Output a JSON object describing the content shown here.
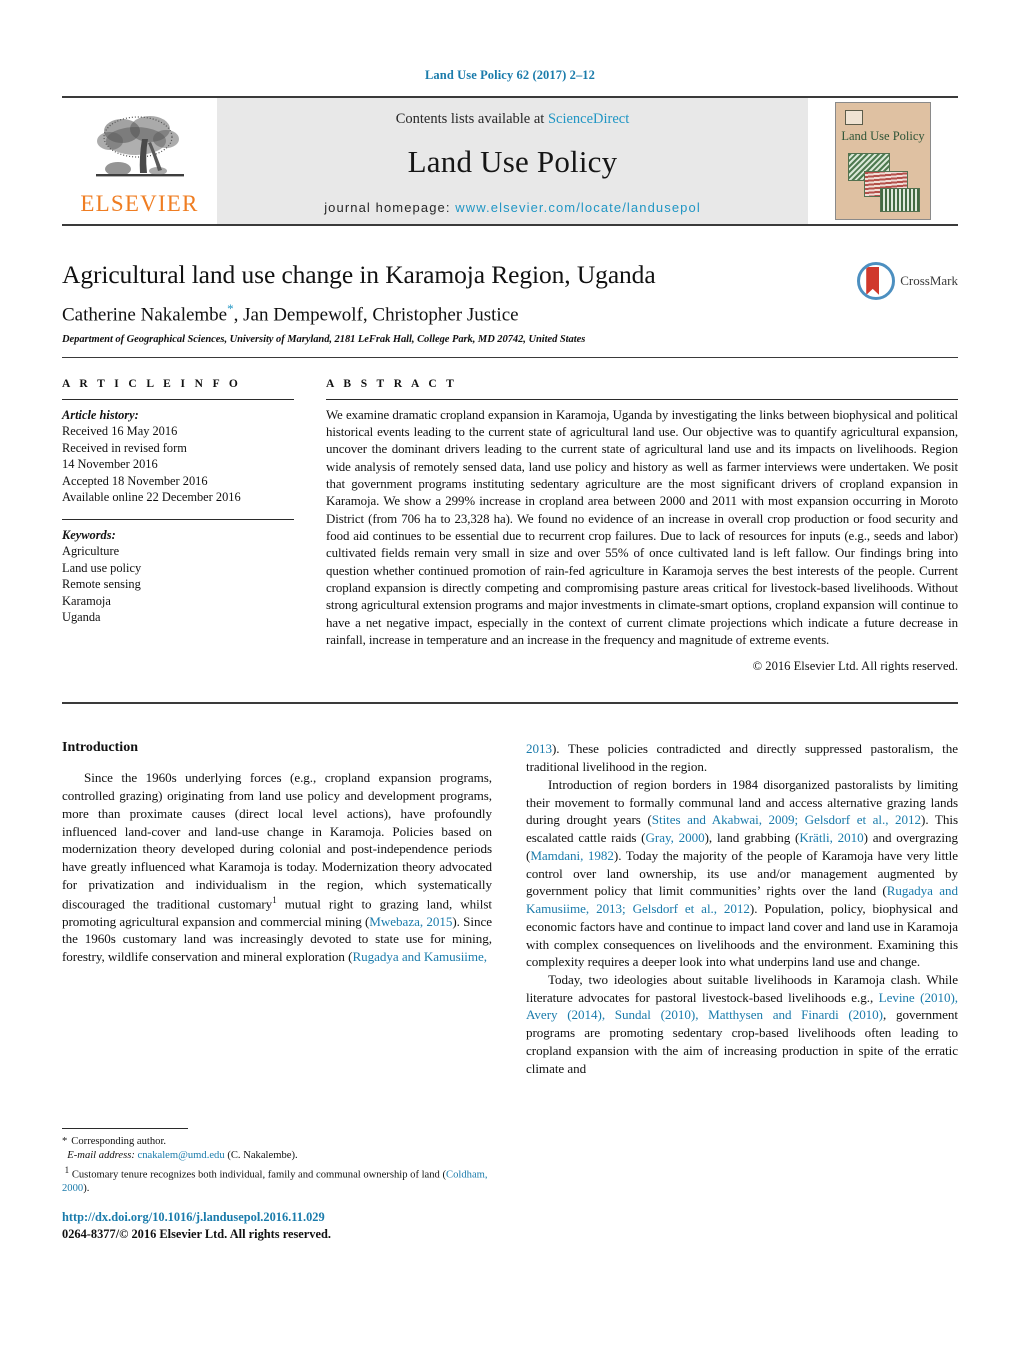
{
  "running_head": "Land Use Policy 62 (2017) 2–12",
  "masthead": {
    "publisher_logo_text": "ELSEVIER",
    "contents_prefix": "Contents lists available at ",
    "contents_link": "ScienceDirect",
    "journal_name": "Land Use Policy",
    "homepage_prefix": "journal homepage: ",
    "homepage_url": "www.elsevier.com/locate/landusepol",
    "cover_title": "Land Use Policy"
  },
  "title_block": {
    "title": "Agricultural land use change in Karamoja Region, Uganda",
    "authors_part1": "Catherine Nakalembe",
    "corresponding_marker": "*",
    "authors_part2": ", Jan Dempewolf, Christopher Justice",
    "affiliation": "Department of Geographical Sciences, University of Maryland, 2181 LeFrak Hall, College Park, MD 20742, United States",
    "crossmark_label": "CrossMark"
  },
  "article_info": {
    "heading": "A R T I C L E   I N F O",
    "history_label": "Article history:",
    "history": [
      "Received 16 May 2016",
      "Received in revised form",
      "14 November 2016",
      "Accepted 18 November 2016",
      "Available online 22 December 2016"
    ],
    "keywords_label": "Keywords:",
    "keywords": [
      "Agriculture",
      "Land use policy",
      "Remote sensing",
      "Karamoja",
      "Uganda"
    ]
  },
  "abstract": {
    "heading": "A B S T R A C T",
    "text": "We examine dramatic cropland expansion in Karamoja, Uganda by investigating the links between biophysical and political historical events leading to the current state of agricultural land use. Our objective was to quantify agricultural expansion, uncover the dominant drivers leading to the current state of agricultural land use and its impacts on livelihoods. Region wide analysis of remotely sensed data, land use policy and history as well as farmer interviews were undertaken. We posit that government programs instituting sedentary agriculture are the most significant drivers of cropland expansion in Karamoja. We show a 299% increase in cropland area between 2000 and 2011 with most expansion occurring in Moroto District (from 706 ha to 23,328 ha). We found no evidence of an increase in overall crop production or food security and food aid continues to be essential due to recurrent crop failures. Due to lack of resources for inputs (e.g., seeds and labor) cultivated fields remain very small in size and over 55% of once cultivated land is left fallow. Our findings bring into question whether continued promotion of rain-fed agriculture in Karamoja serves the best interests of the people. Current cropland expansion is directly competing and compromising pasture areas critical for livestock-based livelihoods. Without strong agricultural extension programs and major investments in climate-smart options, cropland expansion will continue to have a net negative impact, especially in the context of current climate projections which indicate a future decrease in rainfall, increase in temperature and an increase in the frequency and magnitude of extreme events.",
    "copyright": "© 2016 Elsevier Ltd. All rights reserved."
  },
  "introduction": {
    "heading": "Introduction",
    "left_para_1_a": "Since the 1960s underlying forces (e.g., cropland expansion programs, controlled grazing) originating from land use policy and development programs, more than proximate causes (direct local level actions), have profoundly influenced land-cover and land-use change in Karamoja. Policies based on modernization theory developed during colonial and post-independence periods have greatly influenced what Karamoja is today. Modernization theory advocated for privatization and individualism in the region, which systematically discouraged the traditional customary",
    "left_para_1_b": " mutual right to grazing land, whilst promoting agricultural expansion and commercial mining (",
    "left_cite_1": "Mwebaza, 2015",
    "left_para_1_c": "). Since the 1960s customary land was increasingly devoted to state use for mining, forestry, wildlife conservation and mineral exploration (",
    "left_cite_2": "Rugadya and Kamusiime,",
    "right_cite_open": "2013",
    "right_para_1": "). These policies contradicted and directly suppressed pastoralism, the traditional livelihood in the region.",
    "right_para_2_a": "Introduction of region borders in 1984 disorganized pastoralists by limiting their movement to formally communal land and access alternative grazing lands during drought years (",
    "right_cite_a": "Stites and Akabwai, 2009; Gelsdorf et al., 2012",
    "right_para_2_b": "). This escalated cattle raids (",
    "right_cite_b": "Gray, 2000",
    "right_para_2_c": "), land grabbing (",
    "right_cite_c": "Krätli, 2010",
    "right_para_2_d": ") and overgrazing (",
    "right_cite_d": "Mamdani, 1982",
    "right_para_2_e": "). Today the majority of the people of Karamoja have very little control over land ownership, its use and/or management augmented by government policy that limit communities’ rights over the land (",
    "right_cite_e": "Rugadya and Kamusiime, 2013; Gelsdorf et al., 2012",
    "right_para_2_f": "). Population, policy, biophysical and economic factors have and continue to impact land cover and land use in Karamoja with complex consequences on livelihoods and the environment. Examining this complexity requires a deeper look into what underpins land use and change.",
    "right_para_3_a": "Today, two ideologies about suitable livelihoods in Karamoja clash. While literature advocates for pastoral livestock-based livelihoods e.g., ",
    "right_cite_f": "Levine (2010), Avery (2014), Sundal (2010), Matthysen and Finardi (2010)",
    "right_para_3_b": ", government programs are promoting sedentary crop-based livelihoods often leading to cropland expansion with the aim of increasing production in spite of the erratic climate and"
  },
  "footnotes": {
    "corresponding_marker": "*",
    "corresponding_text": "Corresponding author.",
    "email_label": "E-mail address:",
    "email": "cnakalem@umd.edu",
    "email_suffix": "(C. Nakalembe).",
    "fn1_marker": "1",
    "fn1_text_a": "Customary tenure recognizes both individual, family and communal ownership of land (",
    "fn1_cite": "Coldham, 2000",
    "fn1_text_b": ")."
  },
  "footer": {
    "doi": "http://dx.doi.org/10.1016/j.landusepol.2016.11.029",
    "issn": "0264-8377/© 2016 Elsevier Ltd. All rights reserved."
  },
  "colors": {
    "link": "#1a7bab",
    "sciencedirect": "#2196c4",
    "elsevier_orange": "#ef7d22"
  }
}
